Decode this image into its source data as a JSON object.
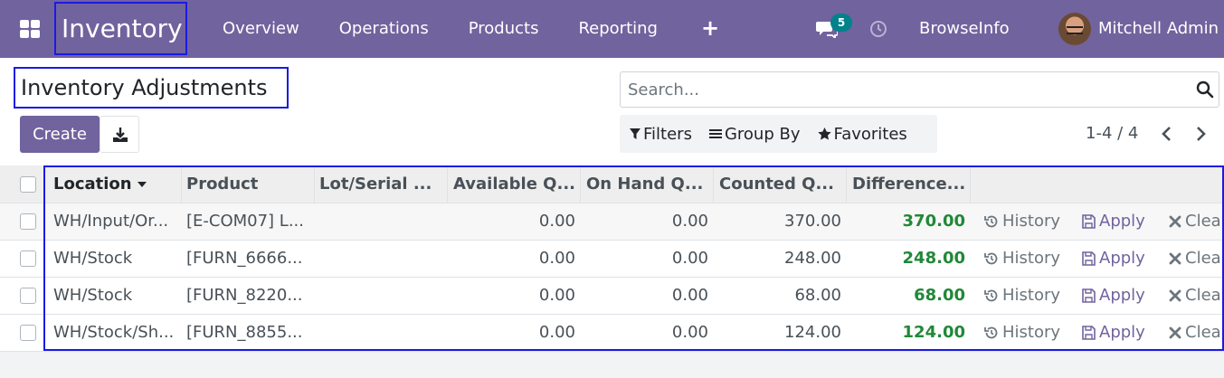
{
  "navbar": {
    "app_name": "Inventory",
    "menu": [
      "Overview",
      "Operations",
      "Products",
      "Reporting"
    ],
    "chat_count": "5",
    "company": "BrowseInfo",
    "user": "Mitchell Admin"
  },
  "control_panel": {
    "title": "Inventory Adjustments",
    "search_placeholder": "Search...",
    "create_label": "Create",
    "filters_label": "Filters",
    "groupby_label": "Group By",
    "favorites_label": "Favorites",
    "pager": "1-4 / 4"
  },
  "table": {
    "headers": [
      "Location",
      "Product",
      "Lot/Serial ...",
      "Available Q...",
      "On Hand Q...",
      "Counted Q...",
      "Difference..."
    ],
    "rows": [
      {
        "location": "WH/Input/Or...",
        "product": "[E-COM07] L...",
        "lot": "",
        "available": "0.00",
        "on_hand": "0.00",
        "counted": "370.00",
        "difference": "370.00"
      },
      {
        "location": "WH/Stock",
        "product": "[FURN_6666...",
        "lot": "",
        "available": "0.00",
        "on_hand": "0.00",
        "counted": "248.00",
        "difference": "248.00"
      },
      {
        "location": "WH/Stock",
        "product": "[FURN_8220...",
        "lot": "",
        "available": "0.00",
        "on_hand": "0.00",
        "counted": "68.00",
        "difference": "68.00"
      },
      {
        "location": "WH/Stock/Sh...",
        "product": "[FURN_8855...",
        "lot": "",
        "available": "0.00",
        "on_hand": "0.00",
        "counted": "124.00",
        "difference": "124.00"
      }
    ],
    "actions": {
      "history": "History",
      "apply": "Apply",
      "clear": "Clear"
    }
  },
  "colors": {
    "brand": "#71639e",
    "positive": "#218838",
    "badge": "#00828a"
  }
}
